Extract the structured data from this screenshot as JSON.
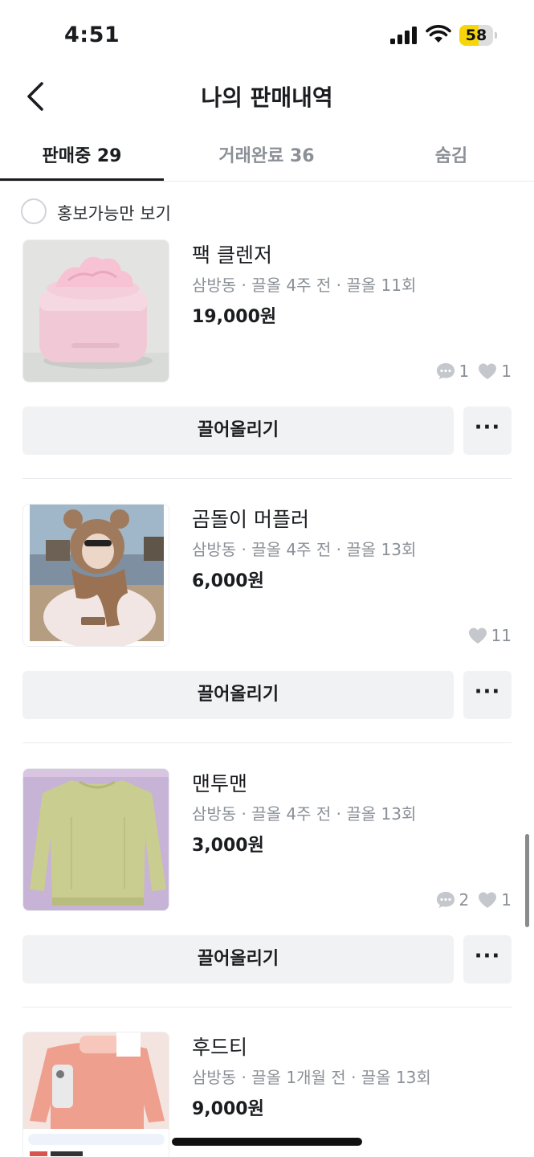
{
  "status_bar": {
    "time": "4:51",
    "battery": "58",
    "battery_level": 0.58,
    "battery_color": "#f6d60b"
  },
  "header": {
    "title": "나의 판매내역",
    "back_icon": "chevron-left-icon"
  },
  "tabs": [
    {
      "label": "판매중 29",
      "active": true
    },
    {
      "label": "거래완료 36",
      "active": false
    },
    {
      "label": "숨김",
      "active": false
    }
  ],
  "filter": {
    "label": "홍보가능만 보기",
    "checked": false
  },
  "items": [
    {
      "title": "팩 클렌저",
      "meta": "삼방동 · 끌올 4주 전 · 끌올 11회",
      "price": "19,000원",
      "chats": "1",
      "likes": "1",
      "image": "pink-cream-jar",
      "bump_label": "끌어올리기",
      "more_label": "···"
    },
    {
      "title": "곰돌이 머플러",
      "meta": "삼방동 · 끌올 4주 전 · 끌올 13회",
      "price": "6,000원",
      "likes": "11",
      "image": "bear-hood-muffler",
      "bump_label": "끌어올리기",
      "more_label": "···"
    },
    {
      "title": "맨투맨",
      "meta": "삼방동 · 끌올 4주 전 · 끌올 13회",
      "price": "3,000원",
      "chats": "2",
      "likes": "1",
      "image": "green-sweatshirt",
      "bump_label": "끌어올리기",
      "more_label": "···"
    },
    {
      "title": "후드티",
      "meta": "삼방동 · 끌올 1개월 전 · 끌올 13회",
      "price": "9,000원",
      "image": "pink-fleece-hoodie"
    }
  ],
  "icons": {
    "chat": "chat-bubble-icon",
    "like": "heart-icon",
    "signal": "cellular-signal-icon",
    "wifi": "wifi-icon",
    "battery": "battery-icon"
  }
}
